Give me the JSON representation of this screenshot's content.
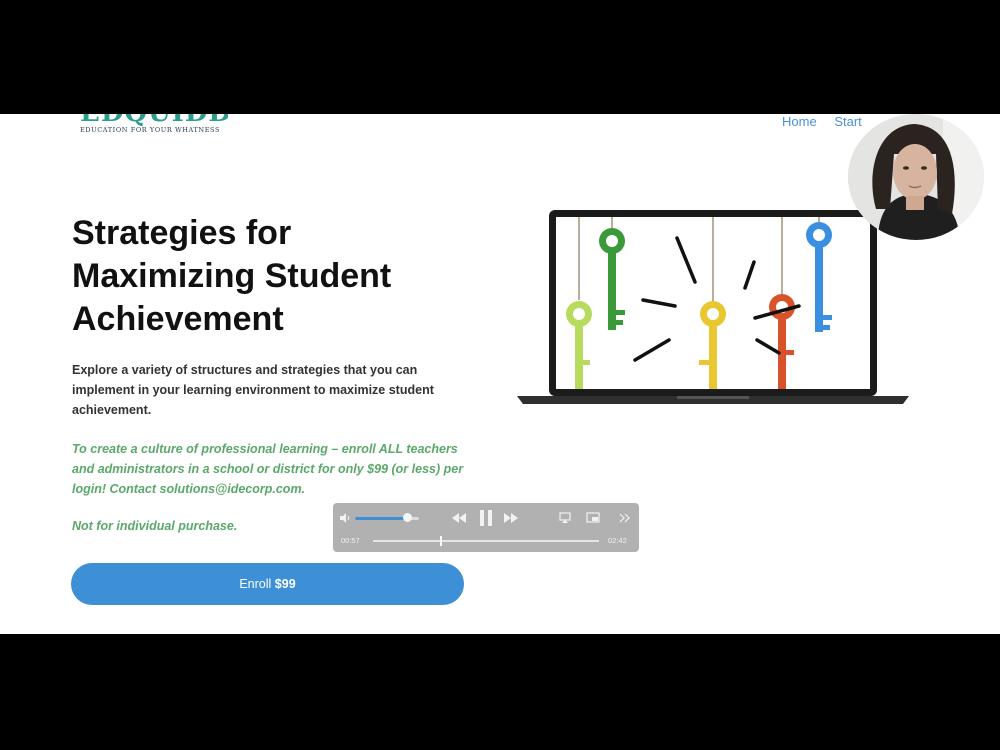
{
  "site": {
    "logo_text": "EDQUIDDITY",
    "logo_tagline": "EDUCATION FOR YOUR WHATNESS",
    "nav": [
      {
        "label": "Home"
      },
      {
        "label": "Start"
      }
    ]
  },
  "hero": {
    "title_line1": "Strategies for",
    "title_line2": "Maximizing Student",
    "title_line3": "Achievement",
    "description": "Explore a variety of structures and strategies that you can implement in your learning environment to maximize student achievement.",
    "promo": "To create a culture of professional learning – enroll ALL teachers and administrators in a school or district for only $99 (or less) per login! Contact solutions@idecorp.com.",
    "notice": "Not for individual purchase.",
    "enroll_label": "Enroll",
    "enroll_price": "$99"
  },
  "player": {
    "elapsed": "00:57",
    "duration": "02:42",
    "volume": 0.82,
    "progress": 0.3
  },
  "colors": {
    "accent_blue": "#3d8fd6",
    "promo_green": "#5aa86a",
    "logo_teal": "#2a9d8f"
  }
}
